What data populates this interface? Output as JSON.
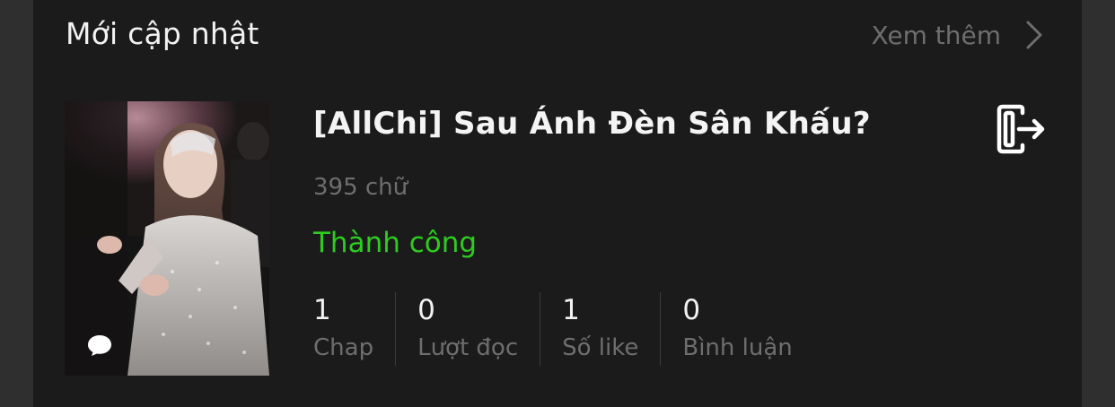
{
  "section": {
    "title": "Mới cập nhật",
    "see_more_label": "Xem thêm",
    "see_more_icon": "chevron-right-icon"
  },
  "book": {
    "cover_icon": "chat-bubble-icon",
    "title": "[AllChi] Sau Ánh Đèn Sân Khấu?",
    "action_icon": "export-icon",
    "word_count": "395 chữ",
    "status": "Thành công",
    "stats": [
      {
        "value": "1",
        "label": "Chap"
      },
      {
        "value": "0",
        "label": "Lượt đọc"
      },
      {
        "value": "1",
        "label": "Số like"
      },
      {
        "value": "0",
        "label": "Bình luận"
      }
    ]
  },
  "colors": {
    "background": "#1b1b1b",
    "status_green": "#2ecb21",
    "muted_text": "#6e6e6e"
  }
}
